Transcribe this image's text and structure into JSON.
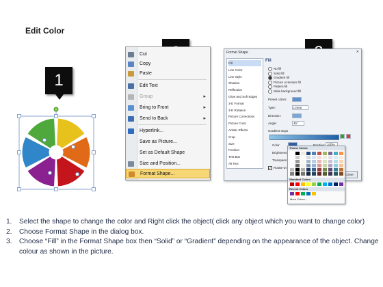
{
  "title": "Edit Color",
  "badges": [
    "1",
    "2",
    "3"
  ],
  "context_menu": {
    "items": [
      {
        "label": "Cut",
        "underline": "t",
        "icon": "scissors-icon",
        "disabled": false,
        "submenu": false
      },
      {
        "label": "Copy",
        "underline": "C",
        "icon": "copy-icon",
        "disabled": false,
        "submenu": false
      },
      {
        "label": "Paste",
        "underline": "P",
        "icon": "paste-icon",
        "disabled": false,
        "submenu": false
      },
      {
        "label": "Edit Text",
        "underline": "x",
        "icon": "edit-text-icon",
        "disabled": false,
        "submenu": false
      },
      {
        "label": "Group",
        "underline": "G",
        "icon": "group-icon",
        "disabled": true,
        "submenu": true
      },
      {
        "label": "Bring to Front",
        "underline": "r",
        "icon": "bring-front-icon",
        "disabled": false,
        "submenu": true
      },
      {
        "label": "Send to Back",
        "underline": "k",
        "icon": "send-back-icon",
        "disabled": false,
        "submenu": true
      },
      {
        "label": "Hyperlink...",
        "underline": "H",
        "icon": "hyperlink-icon",
        "disabled": false,
        "submenu": false
      },
      {
        "label": "Save as Picture...",
        "underline": "S",
        "icon": "",
        "disabled": false,
        "submenu": false
      },
      {
        "label": "Set as Default Shape",
        "underline": "D",
        "icon": "",
        "disabled": false,
        "submenu": false
      },
      {
        "label": "Size and Position...",
        "underline": "z",
        "icon": "size-icon",
        "disabled": false,
        "submenu": false
      },
      {
        "label": "Format Shape...",
        "underline": "o",
        "icon": "format-shape-icon",
        "disabled": false,
        "submenu": false,
        "highlighted": true
      }
    ]
  },
  "dialog": {
    "title": "Format Shape",
    "categories": [
      "Fill",
      "Line Color",
      "Line Style",
      "Shadow",
      "Reflection",
      "Glow and Soft Edges",
      "3-D Format",
      "3-D Rotation",
      "Picture Corrections",
      "Picture Color",
      "Artistic Effects",
      "Crop",
      "Size",
      "Position",
      "Text Box",
      "Alt Text"
    ],
    "selected_category": "Fill",
    "heading": "Fill",
    "fill_options": [
      "No fill",
      "Solid fill",
      "Gradient fill",
      "Picture or texture fill",
      "Pattern fill",
      "Slide background fill"
    ],
    "selected_fill": "Gradient fill",
    "fields": {
      "preset_colors": "Preset colors:",
      "type_label": "Type:",
      "type_value": "Linear",
      "direction_label": "Direction:",
      "angle_label": "Angle:",
      "angle_value": "45°",
      "gradient_stops": "Gradient stops",
      "color_label": "Color",
      "position_label": "Position:",
      "position_value": "100%",
      "brightness_label": "Brightness:",
      "transparency_label": "Transparen",
      "rotate_label": "Rotate wi"
    },
    "close": "Close"
  },
  "color_popup": {
    "theme": "Theme Colors",
    "standard": "Standard Colors",
    "recent": "Recent Colors",
    "more": "More Colors..."
  },
  "colors": {
    "theme_row": [
      "#ffffff",
      "#000000",
      "#eeece1",
      "#1f497d",
      "#4f81bd",
      "#c0504d",
      "#9bbb59",
      "#8064a2",
      "#4bacc6",
      "#f79646"
    ],
    "standard_row": [
      "#c00000",
      "#ff0000",
      "#ffc000",
      "#ffff00",
      "#92d050",
      "#00b050",
      "#00b0f0",
      "#0070c0",
      "#002060",
      "#7030a0"
    ],
    "recent_row": [
      "#7030a0",
      "#ff0000",
      "#00b050",
      "#0070c0",
      "#ffc000"
    ],
    "pie": [
      "#e8c21c",
      "#e06a18",
      "#c4151c",
      "#8b2090",
      "#2f86c8",
      "#4fa83c"
    ]
  },
  "steps": [
    {
      "n": "1.",
      "text": "Select the shape to change the color and Right click the object( click any object which you want to change color)"
    },
    {
      "n": "2.",
      "text": "Choose Format Shape in the dialog box."
    },
    {
      "n": "3.",
      "text": "Choose “Fill” in the Format Shape box then “Solid” or “Gradient” depending on the appearance of the object. Change colour as shown in the picture."
    }
  ]
}
